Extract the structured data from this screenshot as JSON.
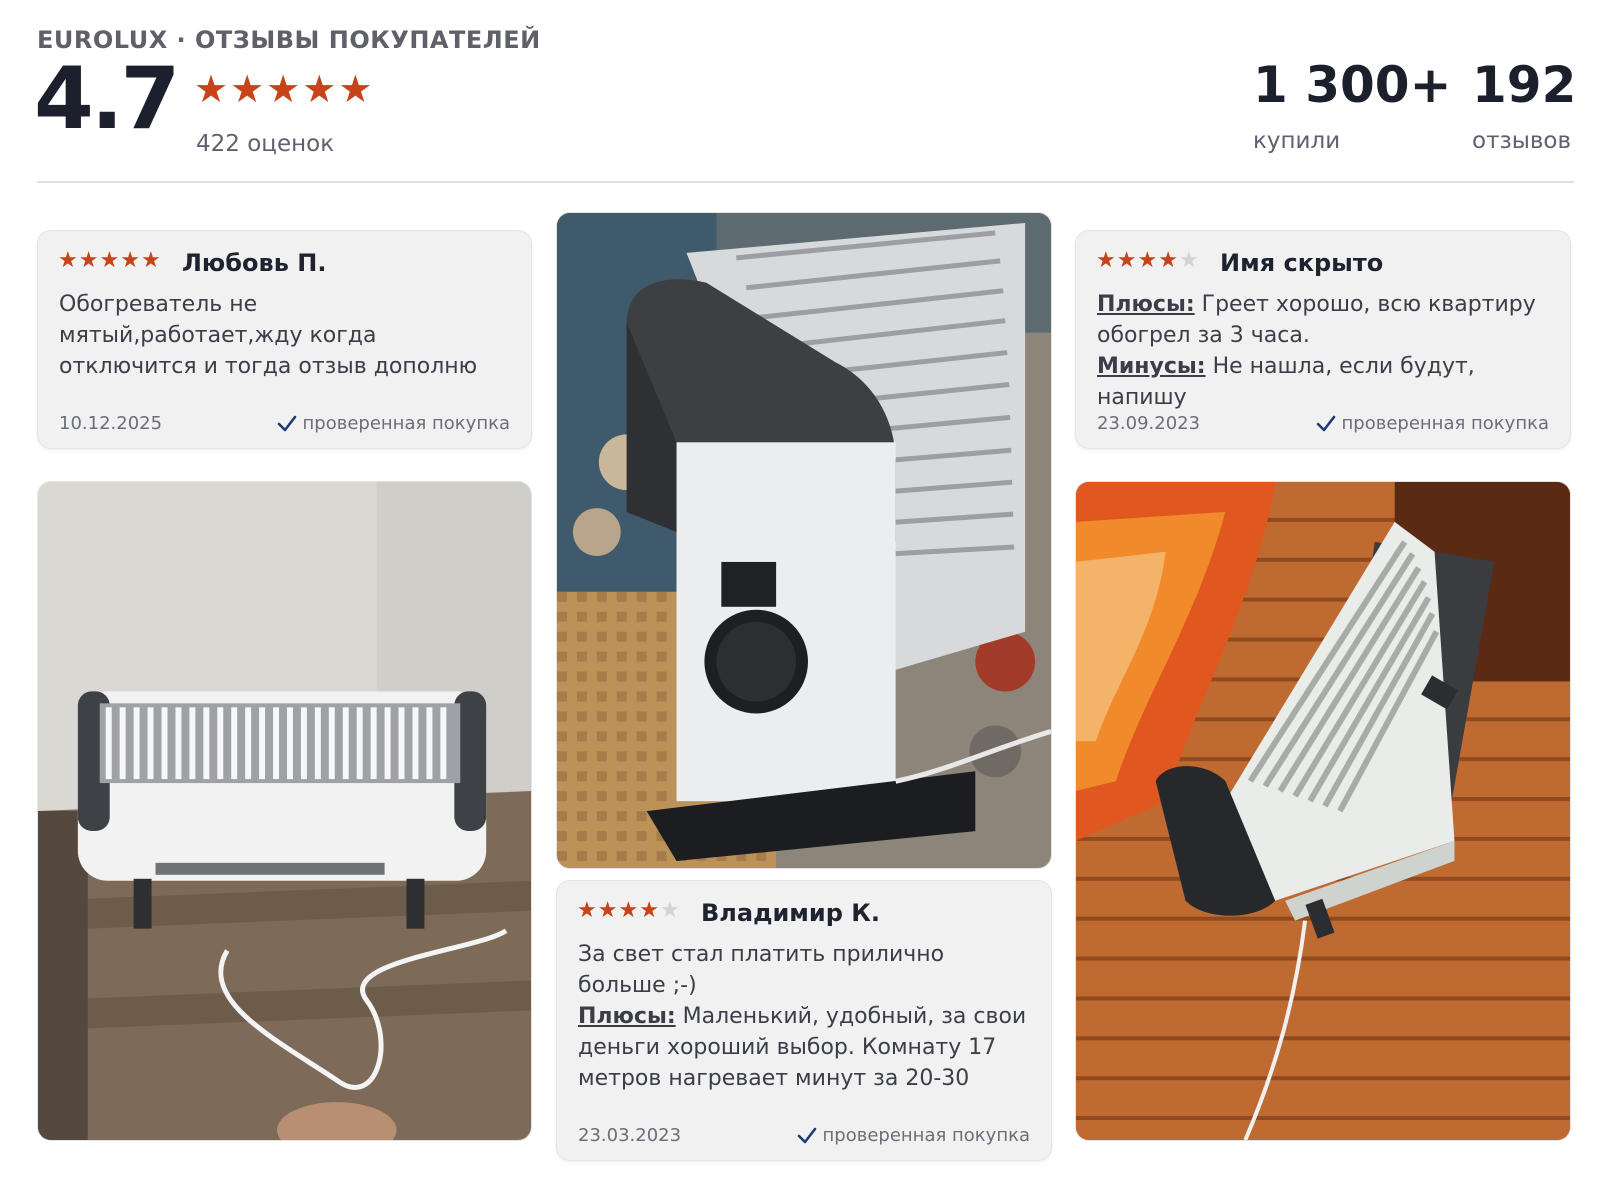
{
  "header": {
    "brand": "EUROLUX · ОТЗЫВЫ ПОКУПАТЕЛЕЙ",
    "rating": "4.7",
    "rating_stars": 5,
    "ratings_count": "422 оценок",
    "stats": [
      {
        "value": "1 300+",
        "label": "купили"
      },
      {
        "value": "192",
        "label": "отзывов"
      }
    ]
  },
  "colors": {
    "star": "#c7431a",
    "star_off": "#d3d3d6",
    "verified_check": "#1e3a78"
  },
  "reviews": [
    {
      "name": "Любовь П.",
      "stars": 5,
      "text": "Обогреватель не мятый,работает,жду когда отключится и тогда отзыв дополню",
      "date": "10.12.2025",
      "verified": "проверенная покупка"
    },
    {
      "name": "Имя скрыто",
      "stars": 4,
      "pros_label": "Плюсы:",
      "pros": " Греет хорошо, всю квартиру обогрел за 3 часа.",
      "cons_label": "Минусы:",
      "cons": " Не нашла, если будут, напишу",
      "date": "23.09.2023",
      "verified": "проверенная покупка"
    },
    {
      "name": "Владимир К.",
      "stars": 4,
      "text": "За свет стал платить прилично больше ;-)",
      "pros_label": "Плюсы:",
      "pros": " Маленький, удобный, за свои деньги хороший выбор. Комнату 17 метров нагревает минут за 20-30",
      "date": "23.03.2023",
      "verified": "проверенная покупка"
    }
  ],
  "photos": [
    {
      "alt": "photo-heater-front"
    },
    {
      "alt": "photo-heater-side-closeup"
    },
    {
      "alt": "photo-heater-angled-floor"
    }
  ]
}
